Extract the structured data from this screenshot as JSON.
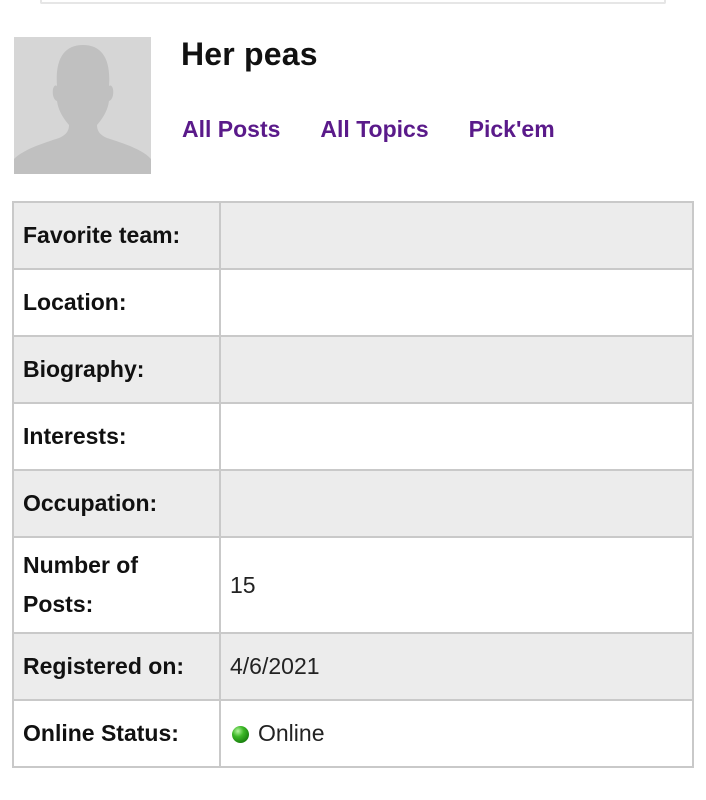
{
  "profile": {
    "username": "Her peas",
    "avatar_icon": "default-user-silhouette-icon",
    "links": [
      {
        "label": "All Posts"
      },
      {
        "label": "All Topics"
      },
      {
        "label": "Pick'em"
      }
    ]
  },
  "details": {
    "favorite_team": {
      "label": "Favorite team:",
      "value": ""
    },
    "location": {
      "label": "Location:",
      "value": ""
    },
    "biography": {
      "label": "Biography:",
      "value": ""
    },
    "interests": {
      "label": "Interests:",
      "value": ""
    },
    "occupation": {
      "label": "Occupation:",
      "value": ""
    },
    "posts": {
      "label_line1": "Number of",
      "label_line2": "Posts:",
      "value": "15"
    },
    "registered": {
      "label": "Registered on:",
      "value": "4/6/2021"
    },
    "status": {
      "label": "Online Status:",
      "value": "Online",
      "indicator_icon": "online-green-dot-icon"
    }
  },
  "colors": {
    "link": "#5a1a8a",
    "row_shade": "#ececec",
    "border": "#c9c9c9",
    "online_indicator": "#3cb826"
  }
}
